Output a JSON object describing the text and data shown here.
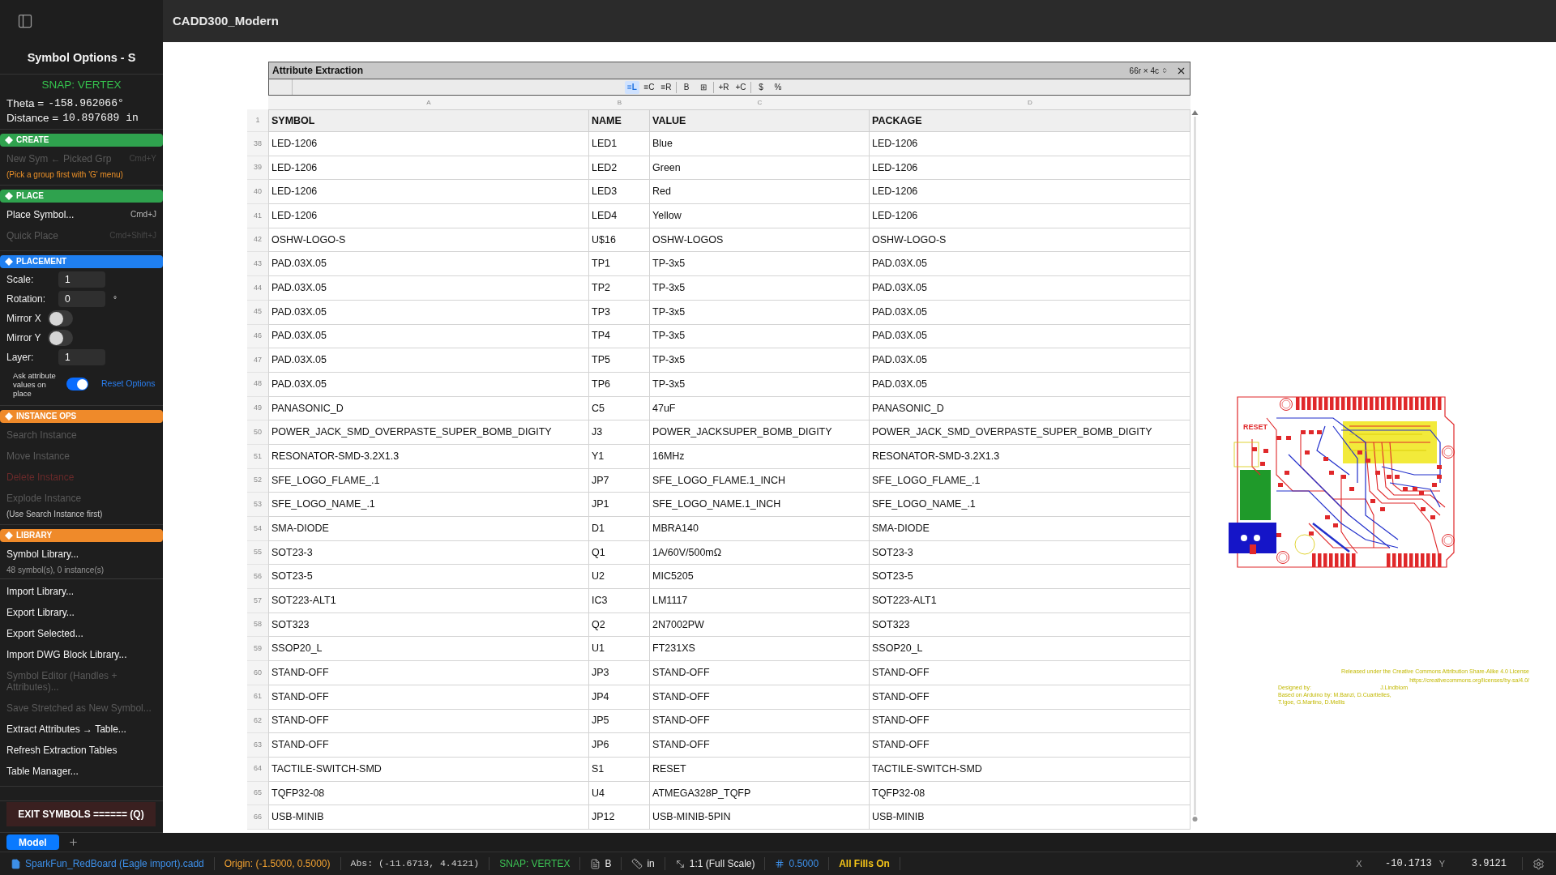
{
  "sidebar": {
    "title": "Symbol Options - S",
    "snap": "SNAP: VERTEX",
    "readouts": [
      {
        "label": "Theta =",
        "value": "-158.962066°"
      },
      {
        "label": "Distance =",
        "value": "10.897689 in"
      }
    ],
    "sections": [
      {
        "title": "CREATE",
        "color": "#2fa24e",
        "items": [
          {
            "kind": "command",
            "label": "New Sym ← Picked Grp",
            "shortcut": "Cmd+Y",
            "disabled": true
          },
          {
            "kind": "warning",
            "text": "(Pick a group first with 'G' menu)"
          }
        ]
      },
      {
        "title": "PLACE",
        "color": "#2fa24e",
        "items": [
          {
            "kind": "command",
            "label": "Place Symbol...",
            "shortcut": "Cmd+J",
            "disabled": false
          },
          {
            "kind": "command",
            "label": "Quick Place",
            "shortcut": "Cmd+Shift+J",
            "disabled": true
          }
        ]
      },
      {
        "title": "PLACEMENT",
        "color": "#1f7ff0",
        "items": [
          {
            "kind": "field",
            "label": "Scale:",
            "value": "1"
          },
          {
            "kind": "field",
            "label": "Rotation:",
            "value": "0",
            "unit": "°"
          },
          {
            "kind": "toggle",
            "label": "Mirror X",
            "on": false
          },
          {
            "kind": "toggle",
            "label": "Mirror Y",
            "on": false
          },
          {
            "kind": "field",
            "label": "Layer:",
            "value": "1"
          },
          {
            "kind": "option",
            "label": "Ask attribute values on place",
            "on": true,
            "link": "Reset Options"
          }
        ]
      },
      {
        "title": "INSTANCE OPS",
        "color": "#ef8a2a",
        "items": [
          {
            "kind": "command",
            "label": "Search Instance",
            "disabled": true
          },
          {
            "kind": "command",
            "label": "Move Instance",
            "disabled": true
          },
          {
            "kind": "command",
            "label": "Delete Instance",
            "disabled": true,
            "danger": true
          },
          {
            "kind": "command",
            "label": "Explode Instance",
            "disabled": true
          },
          {
            "kind": "hint",
            "text": "(Use Search Instance first)"
          }
        ]
      },
      {
        "title": "LIBRARY",
        "color": "#ef8a2a",
        "items": [
          {
            "kind": "command",
            "label": "Symbol Library...",
            "disabled": false
          },
          {
            "kind": "caption",
            "text": "48 symbol(s), 0 instance(s)"
          },
          {
            "kind": "separator"
          },
          {
            "kind": "command",
            "label": "Import Library...",
            "disabled": false
          },
          {
            "kind": "command",
            "label": "Export Library...",
            "disabled": false
          },
          {
            "kind": "command",
            "label": "Export Selected...",
            "disabled": false
          },
          {
            "kind": "command",
            "label": "Import DWG Block Library...",
            "disabled": false
          },
          {
            "kind": "command",
            "label": "Symbol Editor (Handles + Attributes)...",
            "disabled": true
          },
          {
            "kind": "command",
            "label": "Save Stretched as New Symbol...",
            "disabled": true
          },
          {
            "kind": "command",
            "label": "Extract Attributes → Table...",
            "disabled": false
          },
          {
            "kind": "command",
            "label": "Refresh Extraction Tables",
            "disabled": false
          },
          {
            "kind": "command",
            "label": "Table Manager...",
            "disabled": false
          }
        ]
      }
    ],
    "exit_button": "EXIT SYMBOLS ====== (Q)"
  },
  "header": {
    "title": "CADD300_Modern"
  },
  "attribute_table": {
    "title": "Attribute Extraction",
    "size": "66r × 4c",
    "toolbar_groups": [
      {
        "buttons": [
          {
            "label": "≡L",
            "selected": true
          },
          {
            "label": "≡C",
            "selected": false
          },
          {
            "label": "≡R",
            "selected": false
          }
        ]
      },
      {
        "buttons": [
          {
            "label": "B",
            "selected": false
          },
          {
            "label": "⊞",
            "selected": false
          }
        ]
      },
      {
        "buttons": [
          {
            "label": "+R",
            "selected": false
          },
          {
            "label": "+C",
            "selected": false
          }
        ]
      },
      {
        "buttons": [
          {
            "label": "$",
            "selected": false
          },
          {
            "label": "%",
            "selected": false
          }
        ]
      }
    ],
    "column_letters": [
      "A",
      "B",
      "C",
      "D"
    ],
    "header": {
      "number": "1",
      "cells": [
        "SYMBOL",
        "NAME",
        "VALUE",
        "PACKAGE"
      ]
    },
    "rows": [
      {
        "number": "38",
        "cells": [
          "LED-1206",
          "LED1",
          "Blue",
          "LED-1206"
        ]
      },
      {
        "number": "39",
        "cells": [
          "LED-1206",
          "LED2",
          "Green",
          "LED-1206"
        ]
      },
      {
        "number": "40",
        "cells": [
          "LED-1206",
          "LED3",
          "Red",
          "LED-1206"
        ]
      },
      {
        "number": "41",
        "cells": [
          "LED-1206",
          "LED4",
          "Yellow",
          "LED-1206"
        ]
      },
      {
        "number": "42",
        "cells": [
          "OSHW-LOGO-S",
          "U$16",
          "OSHW-LOGOS",
          "OSHW-LOGO-S"
        ]
      },
      {
        "number": "43",
        "cells": [
          "PAD.03X.05",
          "TP1",
          "TP-3x5",
          "PAD.03X.05"
        ]
      },
      {
        "number": "44",
        "cells": [
          "PAD.03X.05",
          "TP2",
          "TP-3x5",
          "PAD.03X.05"
        ]
      },
      {
        "number": "45",
        "cells": [
          "PAD.03X.05",
          "TP3",
          "TP-3x5",
          "PAD.03X.05"
        ]
      },
      {
        "number": "46",
        "cells": [
          "PAD.03X.05",
          "TP4",
          "TP-3x5",
          "PAD.03X.05"
        ]
      },
      {
        "number": "47",
        "cells": [
          "PAD.03X.05",
          "TP5",
          "TP-3x5",
          "PAD.03X.05"
        ]
      },
      {
        "number": "48",
        "cells": [
          "PAD.03X.05",
          "TP6",
          "TP-3x5",
          "PAD.03X.05"
        ]
      },
      {
        "number": "49",
        "cells": [
          "PANASONIC_D",
          "C5",
          "47uF",
          "PANASONIC_D"
        ]
      },
      {
        "number": "50",
        "cells": [
          "POWER_JACK_SMD_OVERPASTE_SUPER_BOMB_DIGITY",
          "J3",
          "POWER_JACKSUPER_BOMB_DIGITY",
          "POWER_JACK_SMD_OVERPASTE_SUPER_BOMB_DIGITY"
        ]
      },
      {
        "number": "51",
        "cells": [
          "RESONATOR-SMD-3.2X1.3",
          "Y1",
          "16MHz",
          "RESONATOR-SMD-3.2X1.3"
        ]
      },
      {
        "number": "52",
        "cells": [
          "SFE_LOGO_FLAME_.1",
          "JP7",
          "SFE_LOGO_FLAME.1_INCH",
          "SFE_LOGO_FLAME_.1"
        ]
      },
      {
        "number": "53",
        "cells": [
          "SFE_LOGO_NAME_.1",
          "JP1",
          "SFE_LOGO_NAME.1_INCH",
          "SFE_LOGO_NAME_.1"
        ]
      },
      {
        "number": "54",
        "cells": [
          "SMA-DIODE",
          "D1",
          "MBRA140",
          "SMA-DIODE"
        ]
      },
      {
        "number": "55",
        "cells": [
          "SOT23-3",
          "Q1",
          "1A/60V/500mΩ",
          "SOT23-3"
        ]
      },
      {
        "number": "56",
        "cells": [
          "SOT23-5",
          "U2",
          "MIC5205",
          "SOT23-5"
        ]
      },
      {
        "number": "57",
        "cells": [
          "SOT223-ALT1",
          "IC3",
          "LM1117",
          "SOT223-ALT1"
        ]
      },
      {
        "number": "58",
        "cells": [
          "SOT323",
          "Q2",
          "2N7002PW",
          "SOT323"
        ]
      },
      {
        "number": "59",
        "cells": [
          "SSOP20_L",
          "U1",
          "FT231XS",
          "SSOP20_L"
        ]
      },
      {
        "number": "60",
        "cells": [
          "STAND-OFF",
          "JP3",
          "STAND-OFF",
          "STAND-OFF"
        ]
      },
      {
        "number": "61",
        "cells": [
          "STAND-OFF",
          "JP4",
          "STAND-OFF",
          "STAND-OFF"
        ]
      },
      {
        "number": "62",
        "cells": [
          "STAND-OFF",
          "JP5",
          "STAND-OFF",
          "STAND-OFF"
        ]
      },
      {
        "number": "63",
        "cells": [
          "STAND-OFF",
          "JP6",
          "STAND-OFF",
          "STAND-OFF"
        ]
      },
      {
        "number": "64",
        "cells": [
          "TACTILE-SWITCH-SMD",
          "S1",
          "RESET",
          "TACTILE-SWITCH-SMD"
        ]
      },
      {
        "number": "65",
        "cells": [
          "TQFP32-08",
          "U4",
          "ATMEGA328P_TQFP",
          "TQFP32-08"
        ]
      },
      {
        "number": "66",
        "cells": [
          "USB-MINIB",
          "JP12",
          "USB-MINIB-5PIN",
          "USB-MINIB"
        ]
      }
    ]
  },
  "canvas": {
    "pcb_labels": [
      "RESET"
    ],
    "license_lines": [
      "Released under the Creative Commons Attribution Share-Alike 4.0 License",
      "https://creativecommons.org/licenses/by-sa/4.0/"
    ],
    "designer": {
      "label": "Designed by:",
      "name": "J.Lindblom"
    },
    "based_on_lines": [
      "Based on Arduino by: M.Banzi, D.Cuartielles,",
      "T.Igoe, G.Martino, D.Mellis"
    ]
  },
  "layout_tabs": [
    {
      "label": "Model",
      "selected": true
    }
  ],
  "status_bar": {
    "items": [
      {
        "kind": "file",
        "text": "SparkFun_RedBoard (Eagle import).cadd"
      },
      {
        "kind": "origin",
        "text": "Origin: (-1.5000, 0.5000)"
      },
      {
        "kind": "abs",
        "text": "Abs: (-11.6713, 4.4121)"
      },
      {
        "kind": "snap",
        "text": "SNAP: VERTEX"
      },
      {
        "kind": "layer",
        "text": "B"
      },
      {
        "kind": "units",
        "text": "in"
      },
      {
        "kind": "scale",
        "text": "1:1 (Full Scale)"
      },
      {
        "kind": "grid",
        "text": "0.5000"
      },
      {
        "kind": "fills",
        "text": "All Fills On"
      }
    ],
    "cursor": [
      {
        "axis": "X",
        "value": "-10.1713"
      },
      {
        "axis": "Y",
        "value": "3.9121"
      }
    ]
  }
}
